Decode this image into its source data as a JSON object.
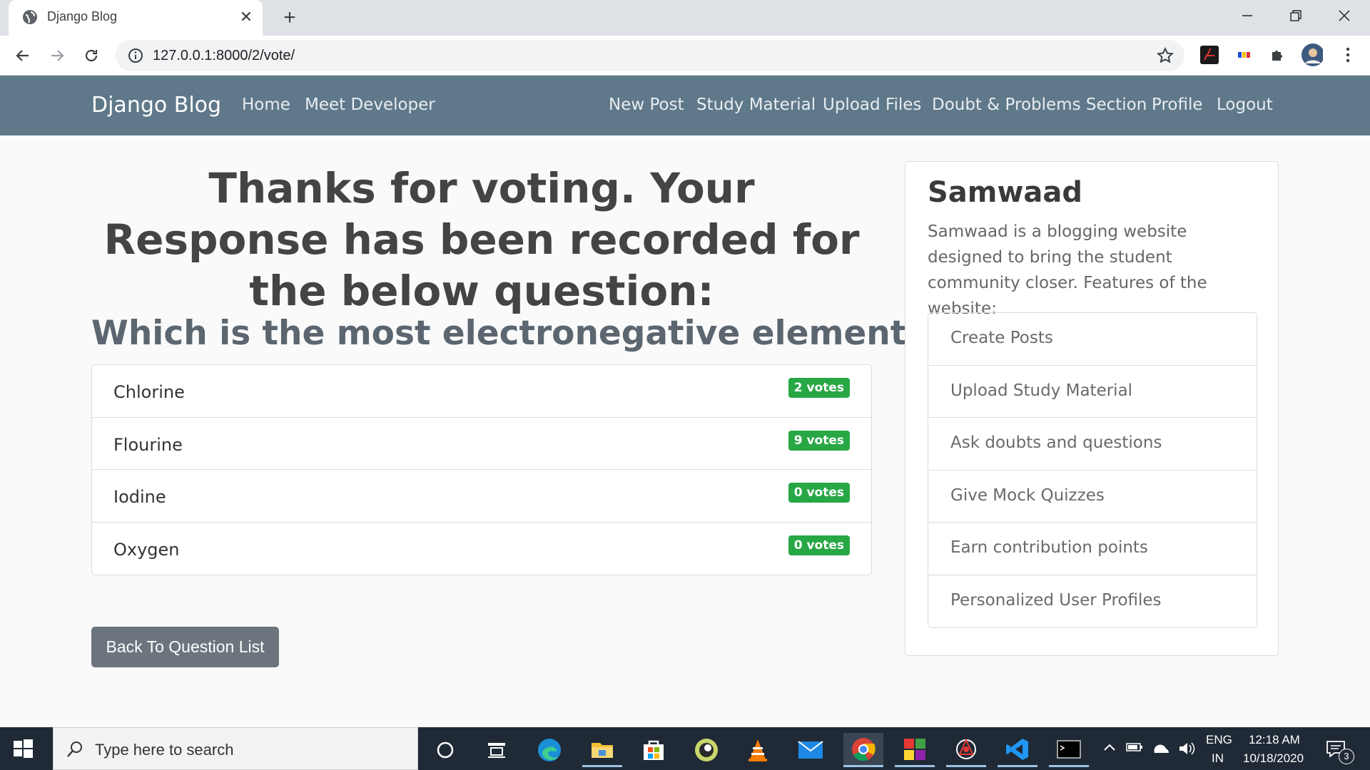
{
  "browser": {
    "tab_title": "Django Blog",
    "url": "127.0.0.1:8000/2/vote/"
  },
  "navbar": {
    "brand": "Django Blog",
    "left_links": [
      "Home",
      "Meet Developer"
    ],
    "right_links": [
      "New Post",
      "Study Material",
      "Upload Files",
      "Doubt & Problems Section",
      "Profile",
      "Logout"
    ]
  },
  "main": {
    "headline": "Thanks for voting. Your Response has been recorded for the below question:",
    "question": "Which is the most electronegative element?",
    "choices": [
      {
        "label": "Chlorine",
        "votes": "2 votes"
      },
      {
        "label": "Flourine",
        "votes": "9 votes"
      },
      {
        "label": "Iodine",
        "votes": "0 votes"
      },
      {
        "label": "Oxygen",
        "votes": "0 votes"
      }
    ],
    "back_button": "Back To Question List"
  },
  "sidebar": {
    "title": "Samwaad",
    "description": "Samwaad is a blogging website designed to bring the student community closer. Features of the website:",
    "features": [
      "Create Posts",
      "Upload Study Material",
      "Ask doubts and questions",
      "Give Mock Quizzes",
      "Earn contribution points",
      "Personalized User Profiles"
    ]
  },
  "taskbar": {
    "search_placeholder": "Type here to search",
    "language_line1": "ENG",
    "language_line2": "IN",
    "time": "12:18 AM",
    "date": "10/18/2020",
    "notifications_count": "3"
  },
  "colors": {
    "navbar_bg": "#5f788a",
    "badge_green": "#28a745",
    "button_gray": "#6c757d",
    "taskbar_bg": "#1f2a36"
  },
  "icons": [
    "globe-icon",
    "close-icon",
    "plus-icon",
    "back-arrow-icon",
    "forward-arrow-icon",
    "reload-icon",
    "info-icon",
    "star-icon",
    "puzzle-icon",
    "windows-icon",
    "search-icon",
    "cortana-icon",
    "task-view-icon"
  ]
}
